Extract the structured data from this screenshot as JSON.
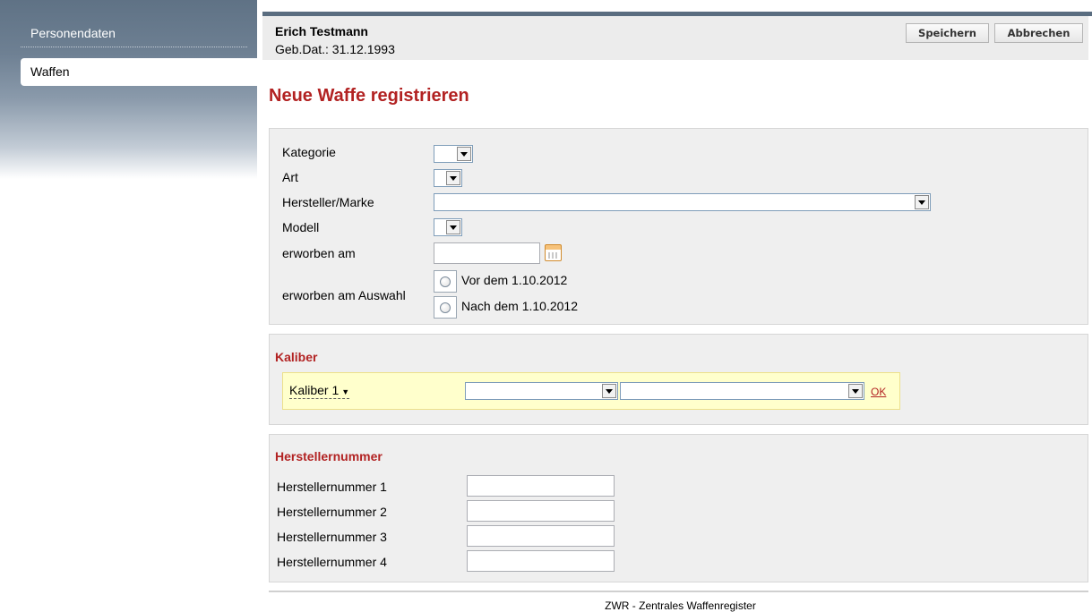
{
  "nav": {
    "items": [
      {
        "label": "Personendaten"
      },
      {
        "label": "Waffen"
      }
    ]
  },
  "person": {
    "name": "Erich Testmann",
    "dob": "Geb.Dat.: 31.12.1993"
  },
  "toolbar": {
    "save_label": "Speichern",
    "cancel_label": "Abbrechen"
  },
  "page": {
    "title": "Neue Waffe registrieren"
  },
  "general": {
    "kategorie_label": "Kategorie",
    "kategorie_value": "",
    "art_label": "Art",
    "art_value": "",
    "hersteller_label": "Hersteller/Marke",
    "hersteller_value": "",
    "modell_label": "Modell",
    "modell_value": "",
    "erworben_label": "erworben am",
    "erworben_value": "",
    "auswahl_label": "erworben am Auswahl",
    "option_before": "Vor dem 1.10.2012",
    "option_after": "Nach dem 1.10.2012"
  },
  "calibre": {
    "title": "Kaliber",
    "row_label": "Kaliber 1",
    "caret": "▼",
    "select1_value": "",
    "select2_value": "",
    "ok_label": "OK"
  },
  "serial": {
    "title": "Herstellernummer",
    "fields": [
      {
        "label": "Herstellernummer 1",
        "value": ""
      },
      {
        "label": "Herstellernummer 2",
        "value": ""
      },
      {
        "label": "Herstellernummer 3",
        "value": ""
      },
      {
        "label": "Herstellernummer 4",
        "value": ""
      }
    ]
  },
  "footer": {
    "text": "ZWR - Zentrales Waffenregister"
  },
  "colors": {
    "accent": "#b22222",
    "nav_dark": "#5f7285",
    "panel_bg": "#efefef",
    "highlight_row": "#ffffcc"
  },
  "icons": {
    "dropdown": "chevron-down-icon",
    "calendar": "calendar-icon",
    "radio": "radio-icon"
  }
}
